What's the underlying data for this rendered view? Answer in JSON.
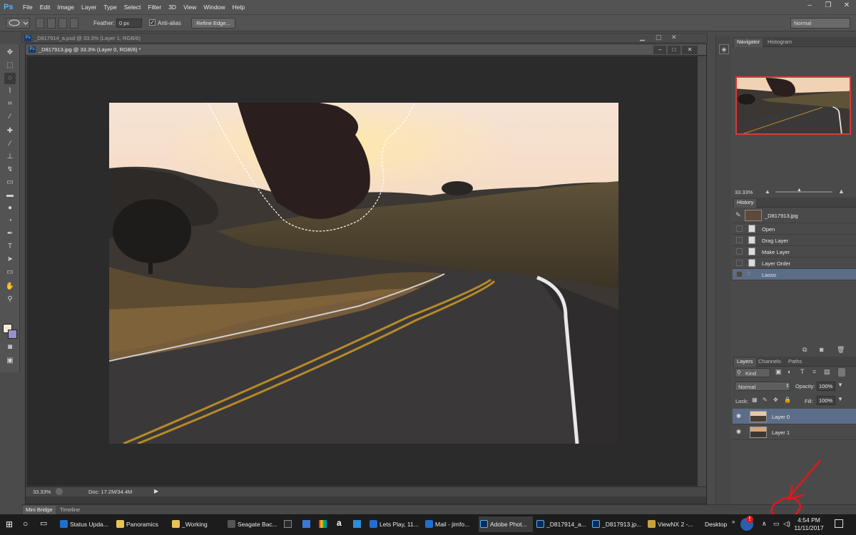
{
  "menubar": {
    "logo": "Ps",
    "items": [
      "File",
      "Edit",
      "Image",
      "Layer",
      "Type",
      "Select",
      "Filter",
      "3D",
      "View",
      "Window",
      "Help"
    ]
  },
  "options": {
    "feather_label": "Feather:",
    "feather_value": "0 px",
    "antialias_label": "Anti-alias",
    "refine_button": "Refine Edge...",
    "blend_mode": "Normal"
  },
  "back_doc_tab": "_D817914_a.psd @ 33.3% (Layer 1, RGB/8)",
  "doc_tab": "_D817913.jpg @ 33.3% (Layer 0, RGB/8) *",
  "doc_status": {
    "zoom": "33.33%",
    "doc_size": "Doc: 17.2M/34.4M"
  },
  "navigator": {
    "tabs": [
      "Navigator",
      "Histogram"
    ],
    "zoom": "33.33%"
  },
  "history": {
    "title": "History",
    "snapshot": "_D817913.jpg",
    "items": [
      "Open",
      "Drag Layer",
      "Make Layer",
      "Layer Order",
      "Lasso"
    ]
  },
  "layers": {
    "tabs": [
      "Layers",
      "Channels",
      "Paths"
    ],
    "kind": "Kind",
    "blend": "Normal",
    "opacity_label": "Opacity:",
    "opacity_value": "100%",
    "lock_label": "Lock:",
    "fill_label": "Fill:",
    "fill_value": "100%",
    "items": [
      "Layer 0",
      "Layer 1"
    ]
  },
  "bottom_tabs": [
    "Mini Bridge",
    "Timeline"
  ],
  "taskbar": {
    "items": [
      "Status Upda...",
      "Panoramics",
      "_Working",
      "Seagate Bac...",
      "Lets Play, 11...",
      "Mail - jimfo...",
      "Adobe Phot...",
      "_D817914_a...",
      "_D817913.jp...",
      "ViewNX 2 -..."
    ],
    "desktop": "Desktop",
    "time": "4:54 PM",
    "date": "11/11/2017"
  },
  "colors": {
    "accent": "#5c6d89",
    "annotation": "#e3161b",
    "logo": "#4fb3ff"
  }
}
